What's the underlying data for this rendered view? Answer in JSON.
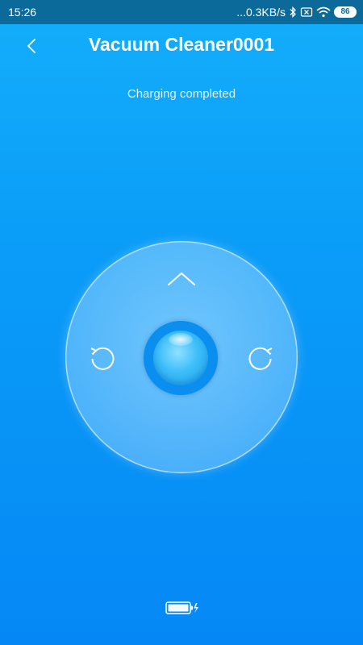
{
  "status_bar": {
    "time": "15:26",
    "network_speed": "...0.3KB/s",
    "battery_level": "86",
    "icons": [
      "bluetooth-icon",
      "sim-disabled-icon",
      "wifi-icon",
      "battery-icon"
    ]
  },
  "header": {
    "title": "Vacuum Cleaner0001",
    "back_icon": "chevron-left-icon"
  },
  "status_message": "Charging completed",
  "controller": {
    "forward_icon": "chevron-up-icon",
    "rotate_left_icon": "rotate-counterclockwise-icon",
    "rotate_right_icon": "rotate-clockwise-icon",
    "center_icon": "start-stop-button"
  },
  "battery_indicator": {
    "icon": "battery-charging-icon",
    "level": 1.0
  },
  "colors": {
    "status_bar": "#0b6a9a",
    "background_top": "#14aefb",
    "background_bottom": "#0588f5",
    "text": "#ffffff"
  }
}
